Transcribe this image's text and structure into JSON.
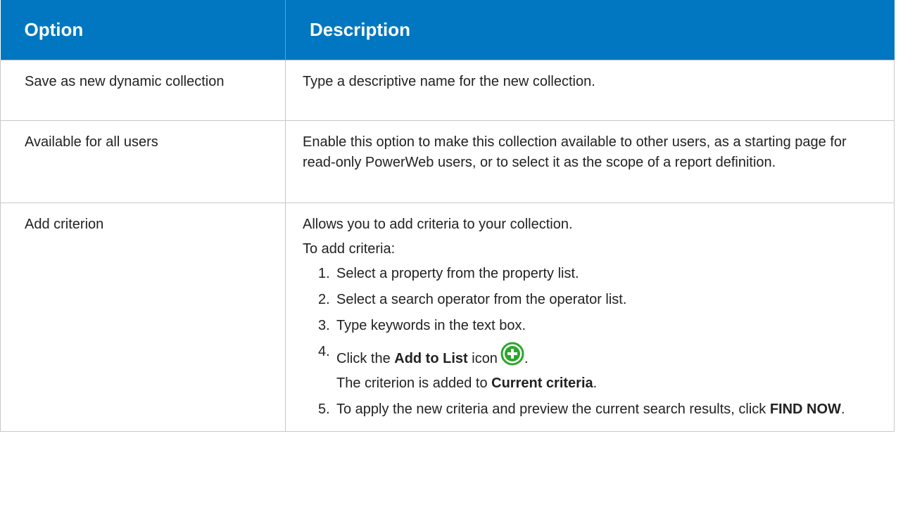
{
  "header": {
    "option": "Option",
    "description": "Description"
  },
  "rows": [
    {
      "option": "Save as new dynamic collection",
      "description": "Type a descriptive name for the new collection."
    },
    {
      "option": "Available for all users",
      "description": "Enable this option to make this collection available to other users, as a starting page for read-only PowerWeb users, or to select it as the scope of a report definition."
    },
    {
      "option": "Add criterion",
      "description": "Allows you to add criteria to your collection."
    }
  ],
  "add_criterion": {
    "intro": "To add criteria:",
    "step1": {
      "num": "1.",
      "text": "Select a property from the property list."
    },
    "step2": {
      "num": "2.",
      "text": "Select a search operator from the operator list."
    },
    "step3": {
      "num": "3.",
      "text": "Type keywords in the text box."
    },
    "step4": {
      "num": "4.",
      "pre": "Click the ",
      "bold": "Add to List",
      "post": " icon",
      "end": ".",
      "sub_pre": "The criterion is added to ",
      "sub_bold": "Current criteria",
      "sub_post": "."
    },
    "step5": {
      "num": "5.",
      "pre": "To apply the new criteria and preview the current search results, click ",
      "bold": "FIND NOW",
      "post": "."
    }
  },
  "icon": {
    "name": "add-circle-icon",
    "color": "#2ea52c"
  },
  "colors": {
    "header_bg": "#0077c0",
    "header_text": "#ffffff",
    "border": "#c9c9c9"
  }
}
